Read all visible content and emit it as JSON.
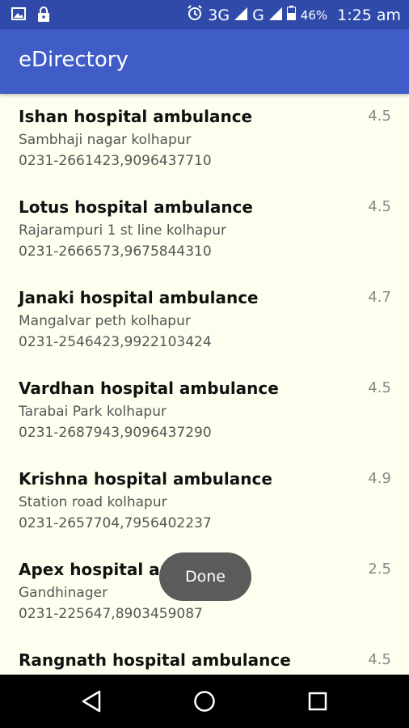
{
  "status_bar": {
    "network_3g": "3G",
    "network_g": "G",
    "battery": "46%",
    "time": "1:25 am",
    "icons": [
      "image-icon",
      "lock-icon",
      "alarm-icon",
      "signal-icon",
      "battery-icon"
    ]
  },
  "app_bar": {
    "title": "eDirectory"
  },
  "colors": {
    "status_bar": "#2f4aa8",
    "app_bar": "#3f5cc7",
    "list_background": "#fffff0",
    "toast": "#5b5b5b",
    "nav_bar": "#000000"
  },
  "items": [
    {
      "name": "Ishan hospital ambulance",
      "address": "Sambhaji nagar kolhapur",
      "phone": "0231-2661423,9096437710",
      "rating": "4.5"
    },
    {
      "name": "Lotus hospital ambulance",
      "address": "Rajarampuri 1 st line kolhapur",
      "phone": "0231-2666573,9675844310",
      "rating": "4.5"
    },
    {
      "name": "Janaki hospital ambulance",
      "address": "Mangalvar peth kolhapur",
      "phone": "0231-2546423,9922103424",
      "rating": "4.7"
    },
    {
      "name": "Vardhan hospital ambulance",
      "address": "Tarabai Park kolhapur",
      "phone": "0231-2687943,9096437290",
      "rating": "4.5"
    },
    {
      "name": "Krishna hospital ambulance",
      "address": "Station road kolhapur",
      "phone": "0231-2657704,7956402237",
      "rating": "4.9"
    },
    {
      "name": "Apex hospital ambulance",
      "address": "Gandhinager",
      "phone": "0231-225647,8903459087",
      "rating": "2.5"
    },
    {
      "name": "Rangnath hospital ambulance",
      "address": "",
      "phone": "",
      "rating": "4.5"
    }
  ],
  "toast": {
    "text": "Done"
  },
  "nav_bar": {
    "buttons": [
      "back-icon",
      "home-icon",
      "recents-icon"
    ]
  }
}
